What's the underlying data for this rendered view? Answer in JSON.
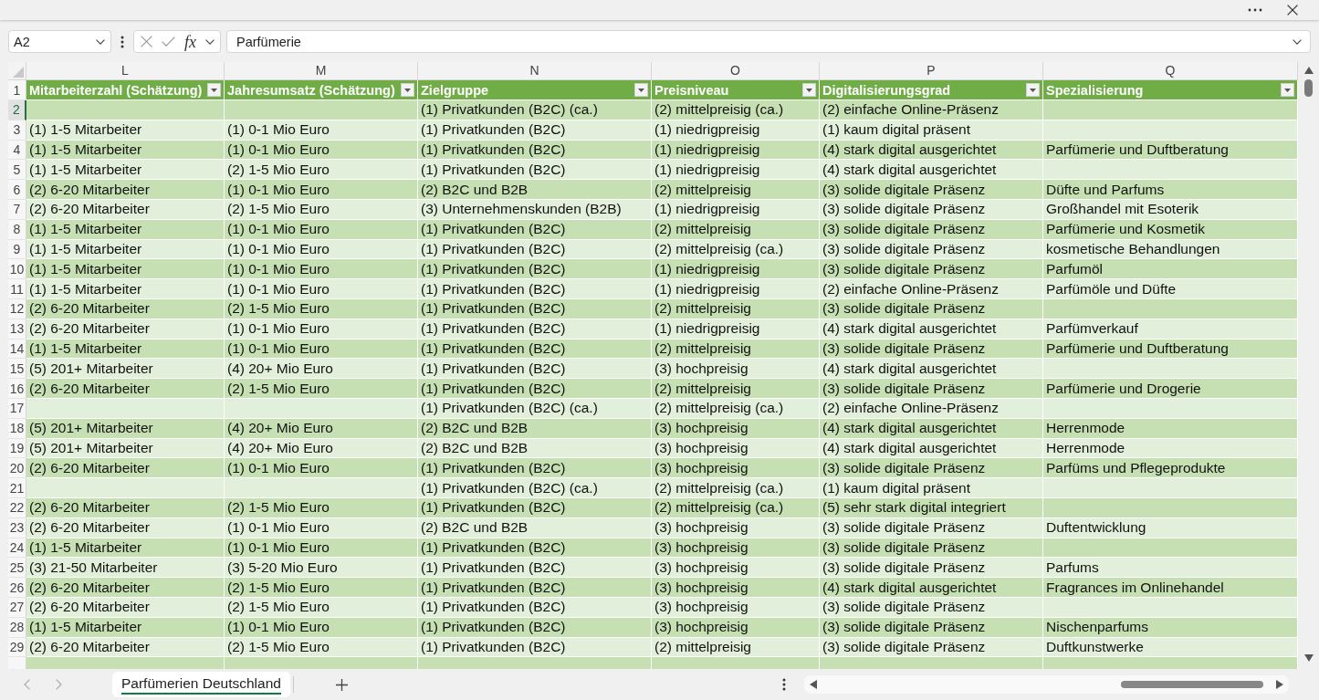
{
  "formula_bar": {
    "name_box": "A2",
    "function_label": "fx",
    "formula": "Parfümerie"
  },
  "sheet": {
    "column_letters": [
      "L",
      "M",
      "N",
      "O",
      "P",
      "Q"
    ],
    "header_row_number": "1",
    "headers": [
      "Mitarbeiterzahl (Schätzung)",
      "Jahresumsatz (Schätzung)",
      "Zielgruppe",
      "Preisniveau",
      "Digitalisierungsgrad",
      "Spezialisierung"
    ],
    "rows": [
      {
        "number": "2",
        "selected": true,
        "cells": [
          null,
          null,
          "(1) Privatkunden (B2C) (ca.)",
          "(2) mittelpreisig (ca.)",
          "(2) einfache Online-Präsenz",
          null
        ]
      },
      {
        "number": "3",
        "selected": false,
        "cells": [
          "(1) 1-5 Mitarbeiter",
          "(1) 0-1 Mio Euro",
          "(1) Privatkunden (B2C)",
          "(1) niedrigpreisig",
          "(1) kaum digital präsent",
          null
        ]
      },
      {
        "number": "4",
        "selected": false,
        "cells": [
          "(1) 1-5 Mitarbeiter",
          "(1) 0-1 Mio Euro",
          "(1) Privatkunden (B2C)",
          "(1) niedrigpreisig",
          "(4) stark digital ausgerichtet",
          "Parfümerie und Duftberatung"
        ]
      },
      {
        "number": "5",
        "selected": false,
        "cells": [
          "(1) 1-5 Mitarbeiter",
          "(2) 1-5 Mio Euro",
          "(1) Privatkunden (B2C)",
          "(1) niedrigpreisig",
          "(4) stark digital ausgerichtet",
          null
        ]
      },
      {
        "number": "6",
        "selected": false,
        "cells": [
          "(2) 6-20 Mitarbeiter",
          "(1) 0-1 Mio Euro",
          "(2) B2C und B2B",
          "(2) mittelpreisig",
          "(3) solide digitale Präsenz",
          "Düfte und Parfums"
        ]
      },
      {
        "number": "7",
        "selected": false,
        "cells": [
          "(2) 6-20 Mitarbeiter",
          "(2) 1-5 Mio Euro",
          "(3) Unternehmenskunden (B2B)",
          "(1) niedrigpreisig",
          "(3) solide digitale Präsenz",
          "Großhandel mit Esoterik"
        ]
      },
      {
        "number": "8",
        "selected": false,
        "cells": [
          "(1) 1-5 Mitarbeiter",
          "(1) 0-1 Mio Euro",
          "(1) Privatkunden (B2C)",
          "(2) mittelpreisig",
          "(3) solide digitale Präsenz",
          "Parfümerie und Kosmetik"
        ]
      },
      {
        "number": "9",
        "selected": false,
        "cells": [
          "(1) 1-5 Mitarbeiter",
          "(1) 0-1 Mio Euro",
          "(1) Privatkunden (B2C)",
          "(2) mittelpreisig (ca.)",
          "(3) solide digitale Präsenz",
          "kosmetische Behandlungen"
        ]
      },
      {
        "number": "10",
        "selected": false,
        "cells": [
          "(1) 1-5 Mitarbeiter",
          "(1) 0-1 Mio Euro",
          "(1) Privatkunden (B2C)",
          "(1) niedrigpreisig",
          "(3) solide digitale Präsenz",
          "Parfumöl"
        ]
      },
      {
        "number": "11",
        "selected": false,
        "cells": [
          "(1) 1-5 Mitarbeiter",
          "(1) 0-1 Mio Euro",
          "(1) Privatkunden (B2C)",
          "(1) niedrigpreisig",
          "(2) einfache Online-Präsenz",
          "Parfümöle und Düfte"
        ]
      },
      {
        "number": "12",
        "selected": false,
        "cells": [
          "(2) 6-20 Mitarbeiter",
          "(2) 1-5 Mio Euro",
          "(1) Privatkunden (B2C)",
          "(2) mittelpreisig",
          "(3) solide digitale Präsenz",
          null
        ]
      },
      {
        "number": "13",
        "selected": false,
        "cells": [
          "(2) 6-20 Mitarbeiter",
          "(1) 0-1 Mio Euro",
          "(1) Privatkunden (B2C)",
          "(1) niedrigpreisig",
          "(4) stark digital ausgerichtet",
          "Parfümverkauf"
        ]
      },
      {
        "number": "14",
        "selected": false,
        "cells": [
          "(1) 1-5 Mitarbeiter",
          "(1) 0-1 Mio Euro",
          "(1) Privatkunden (B2C)",
          "(2) mittelpreisig",
          "(3) solide digitale Präsenz",
          "Parfümerie und Duftberatung"
        ]
      },
      {
        "number": "15",
        "selected": false,
        "cells": [
          "(5) 201+ Mitarbeiter",
          "(4) 20+ Mio Euro",
          "(1) Privatkunden (B2C)",
          "(3) hochpreisig",
          "(4) stark digital ausgerichtet",
          null
        ]
      },
      {
        "number": "16",
        "selected": false,
        "cells": [
          "(2) 6-20 Mitarbeiter",
          "(2) 1-5 Mio Euro",
          "(1) Privatkunden (B2C)",
          "(2) mittelpreisig",
          "(3) solide digitale Präsenz",
          "Parfümerie und Drogerie"
        ]
      },
      {
        "number": "17",
        "selected": false,
        "cells": [
          null,
          null,
          "(1) Privatkunden (B2C) (ca.)",
          "(2) mittelpreisig (ca.)",
          "(2) einfache Online-Präsenz",
          null
        ]
      },
      {
        "number": "18",
        "selected": false,
        "cells": [
          "(5) 201+ Mitarbeiter",
          "(4) 20+ Mio Euro",
          "(2) B2C und B2B",
          "(3) hochpreisig",
          "(4) stark digital ausgerichtet",
          "Herrenmode"
        ]
      },
      {
        "number": "19",
        "selected": false,
        "cells": [
          "(5) 201+ Mitarbeiter",
          "(4) 20+ Mio Euro",
          "(2) B2C und B2B",
          "(3) hochpreisig",
          "(4) stark digital ausgerichtet",
          "Herrenmode"
        ]
      },
      {
        "number": "20",
        "selected": false,
        "cells": [
          "(2) 6-20 Mitarbeiter",
          "(1) 0-1 Mio Euro",
          "(1) Privatkunden (B2C)",
          "(3) hochpreisig",
          "(3) solide digitale Präsenz",
          "Parfüms und Pflegeprodukte"
        ]
      },
      {
        "number": "21",
        "selected": false,
        "cells": [
          null,
          null,
          "(1) Privatkunden (B2C) (ca.)",
          "(2) mittelpreisig (ca.)",
          "(1) kaum digital präsent",
          null
        ]
      },
      {
        "number": "22",
        "selected": false,
        "cells": [
          "(2) 6-20 Mitarbeiter",
          "(2) 1-5 Mio Euro",
          "(1) Privatkunden (B2C)",
          "(2) mittelpreisig (ca.)",
          "(5) sehr stark digital integriert",
          null
        ]
      },
      {
        "number": "23",
        "selected": false,
        "cells": [
          "(2) 6-20 Mitarbeiter",
          "(1) 0-1 Mio Euro",
          "(2) B2C und B2B",
          "(3) hochpreisig",
          "(3) solide digitale Präsenz",
          "Duftentwicklung"
        ]
      },
      {
        "number": "24",
        "selected": false,
        "cells": [
          "(1) 1-5 Mitarbeiter",
          "(1) 0-1 Mio Euro",
          "(1) Privatkunden (B2C)",
          "(3) hochpreisig",
          "(3) solide digitale Präsenz",
          null
        ]
      },
      {
        "number": "25",
        "selected": false,
        "cells": [
          "(3) 21-50 Mitarbeiter",
          "(3) 5-20 Mio Euro",
          "(1) Privatkunden (B2C)",
          "(3) hochpreisig",
          "(3) solide digitale Präsenz",
          "Parfums"
        ]
      },
      {
        "number": "26",
        "selected": false,
        "cells": [
          "(2) 6-20 Mitarbeiter",
          "(2) 1-5 Mio Euro",
          "(1) Privatkunden (B2C)",
          "(3) hochpreisig",
          "(4) stark digital ausgerichtet",
          "Fragrances im Onlinehandel"
        ]
      },
      {
        "number": "27",
        "selected": false,
        "cells": [
          "(2) 6-20 Mitarbeiter",
          "(2) 1-5 Mio Euro",
          "(1) Privatkunden (B2C)",
          "(3) hochpreisig",
          "(3) solide digitale Präsenz",
          null
        ]
      },
      {
        "number": "28",
        "selected": false,
        "cells": [
          "(1) 1-5 Mitarbeiter",
          "(1) 0-1 Mio Euro",
          "(1) Privatkunden (B2C)",
          "(3) hochpreisig",
          "(3) solide digitale Präsenz",
          "Nischenparfums"
        ]
      },
      {
        "number": "29",
        "selected": false,
        "cells": [
          "(2) 6-20 Mitarbeiter",
          "(2) 1-5 Mio Euro",
          "(1) Privatkunden (B2C)",
          "(2) mittelpreisig",
          "(3) solide digitale Präsenz",
          "Duftkunstwerke"
        ]
      }
    ]
  },
  "sheet_tabs": [
    {
      "label": "Parfümerien Deutschland",
      "selected": true
    }
  ]
}
